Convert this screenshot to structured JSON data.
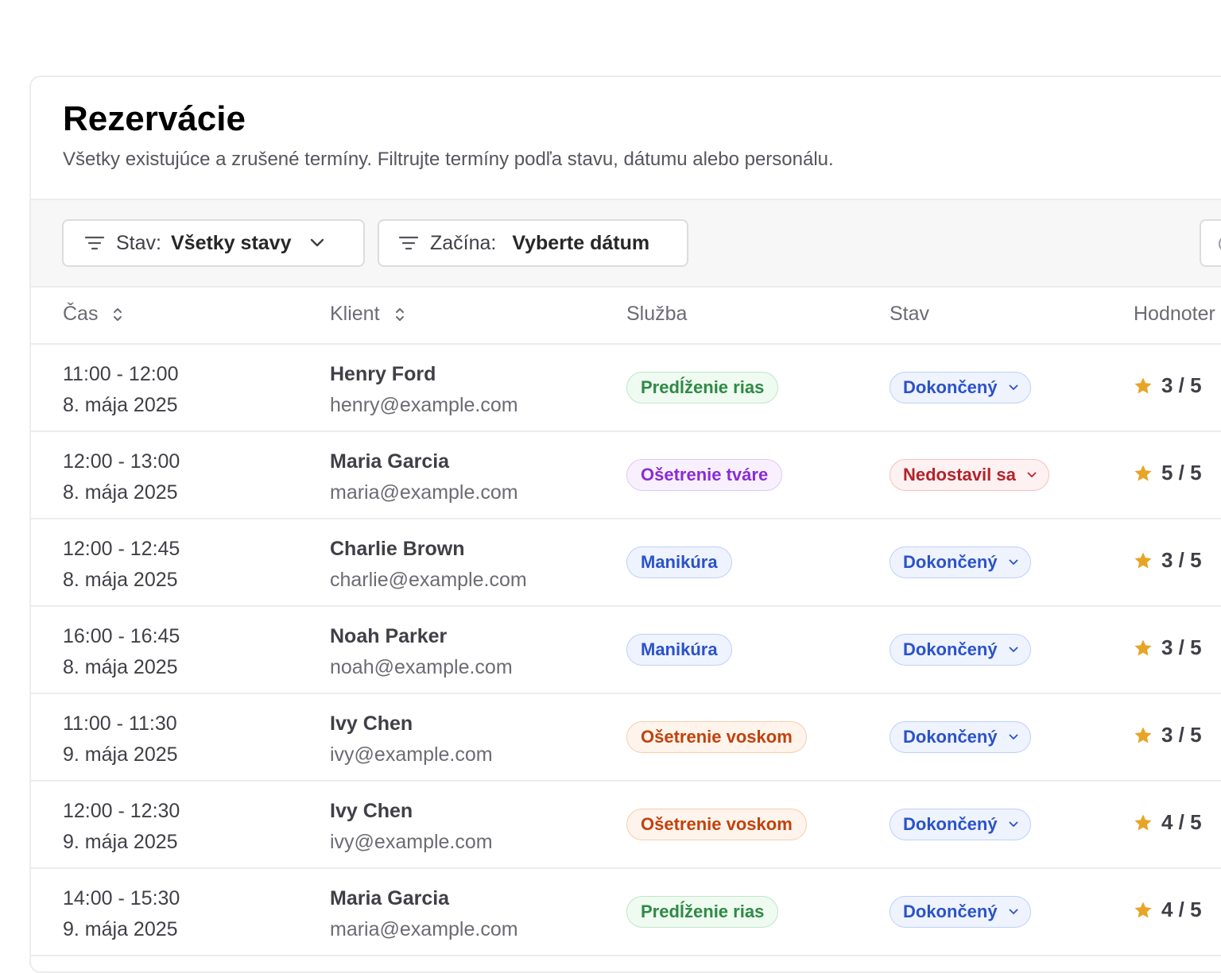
{
  "header": {
    "title": "Rezervácie",
    "subtitle": "Všetky existujúce a zrušené termíny. Filtrujte termíny podľa stavu, dátumu alebo personálu."
  },
  "filters": {
    "status": {
      "label": "Stav:",
      "value": "Všetky stavy",
      "icon": "filter-icon"
    },
    "date": {
      "label": "Začína:",
      "value": "Vyberte dátum",
      "icon": "filter-icon"
    }
  },
  "table": {
    "columns": [
      "Čas",
      "Klient",
      "Služba",
      "Stav",
      "Hodnoter"
    ],
    "rows": [
      {
        "time": "11:00 - 12:00",
        "date": "8. mája 2025",
        "name": "Henry Ford",
        "email": "henry@example.com",
        "service": "Predĺženie rias",
        "service_color": "green",
        "status": "Dokončený",
        "status_color": "blue",
        "rating": "3 / 5"
      },
      {
        "time": "12:00 - 13:00",
        "date": "8. mája 2025",
        "name": "Maria Garcia",
        "email": "maria@example.com",
        "service": "Ošetrenie tváre",
        "service_color": "purple",
        "status": "Nedostavil sa",
        "status_color": "red",
        "rating": "5 / 5"
      },
      {
        "time": "12:00 - 12:45",
        "date": "8. mája 2025",
        "name": "Charlie Brown",
        "email": "charlie@example.com",
        "service": "Manikúra",
        "service_color": "blue",
        "status": "Dokončený",
        "status_color": "blue",
        "rating": "3 / 5"
      },
      {
        "time": "16:00 - 16:45",
        "date": "8. mája 2025",
        "name": "Noah Parker",
        "email": "noah@example.com",
        "service": "Manikúra",
        "service_color": "blue",
        "status": "Dokončený",
        "status_color": "blue",
        "rating": "3 / 5"
      },
      {
        "time": "11:00 - 11:30",
        "date": "9. mája 2025",
        "name": "Ivy Chen",
        "email": "ivy@example.com",
        "service": "Ošetrenie voskom",
        "service_color": "orange",
        "status": "Dokončený",
        "status_color": "blue",
        "rating": "3 / 5"
      },
      {
        "time": "12:00 - 12:30",
        "date": "9. mája 2025",
        "name": "Ivy Chen",
        "email": "ivy@example.com",
        "service": "Ošetrenie voskom",
        "service_color": "orange",
        "status": "Dokončený",
        "status_color": "blue",
        "rating": "4 / 5"
      },
      {
        "time": "14:00 - 15:30",
        "date": "9. mája 2025",
        "name": "Maria Garcia",
        "email": "maria@example.com",
        "service": "Predĺženie rias",
        "service_color": "green",
        "status": "Dokončený",
        "status_color": "blue",
        "rating": "4 / 5"
      }
    ]
  },
  "colors": {
    "star": "#e7a526",
    "border": "#ececef",
    "toolbar_bg": "#f7f7f8"
  }
}
